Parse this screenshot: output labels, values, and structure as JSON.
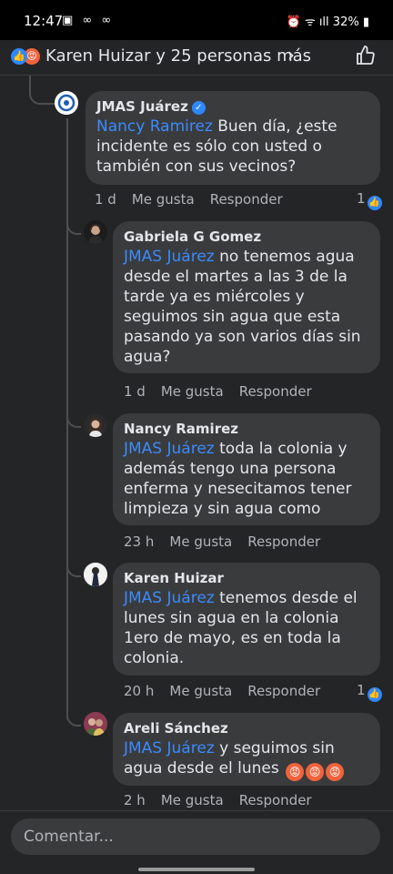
{
  "status_bar": {
    "time": "12:47",
    "left_icons": "▣ ∞ ∞",
    "right_icons": "⏰ ᯤ ıll",
    "battery": "32%"
  },
  "reactions": {
    "summary": "Karen Huizar y 25 personas más",
    "like_icon": "like-icon",
    "angry_icon": "angry-icon"
  },
  "comments": [
    {
      "author": "JMAS Juárez",
      "verified": true,
      "mention": "Nancy Ramirez",
      "text": "Buen día, ¿este incidente es sólo con usted o también con sus vecinos?",
      "time": "1 d",
      "like_label": "Me gusta",
      "reply_label": "Responder",
      "likes": "1"
    },
    {
      "author": "Gabriela G Gomez",
      "mention": "JMAS Juárez",
      "text": "no tenemos agua desde el martes a las 3 de la tarde ya es miércoles y seguimos sin agua que esta pasando ya son varios días sin agua?",
      "time": "1 d",
      "like_label": "Me gusta",
      "reply_label": "Responder"
    },
    {
      "author": "Nancy Ramirez",
      "mention": "JMAS Juárez",
      "text": "toda la colonia y además tengo una persona enferma y nesecitamos tener limpieza y sin agua como",
      "time": "23 h",
      "like_label": "Me gusta",
      "reply_label": "Responder"
    },
    {
      "author": "Karen Huizar",
      "mention": "JMAS Juárez",
      "text": "tenemos desde el lunes sin agua en la colonia 1ero de mayo, es en toda la colonia.",
      "time": "20 h",
      "like_label": "Me gusta",
      "reply_label": "Responder",
      "likes": "1"
    },
    {
      "author": "Areli Sánchez",
      "mention": "JMAS Juárez",
      "text": "y seguimos sin agua desde el lunes",
      "time": "2 h",
      "like_label": "Me gusta",
      "reply_label": "Responder"
    }
  ],
  "composer": {
    "placeholder": "Comentar..."
  },
  "colors": {
    "background": "#242526",
    "bubble": "#3a3b3c",
    "mention": "#3b8bff",
    "like": "#2d88ff",
    "angry": "#f0633c"
  }
}
